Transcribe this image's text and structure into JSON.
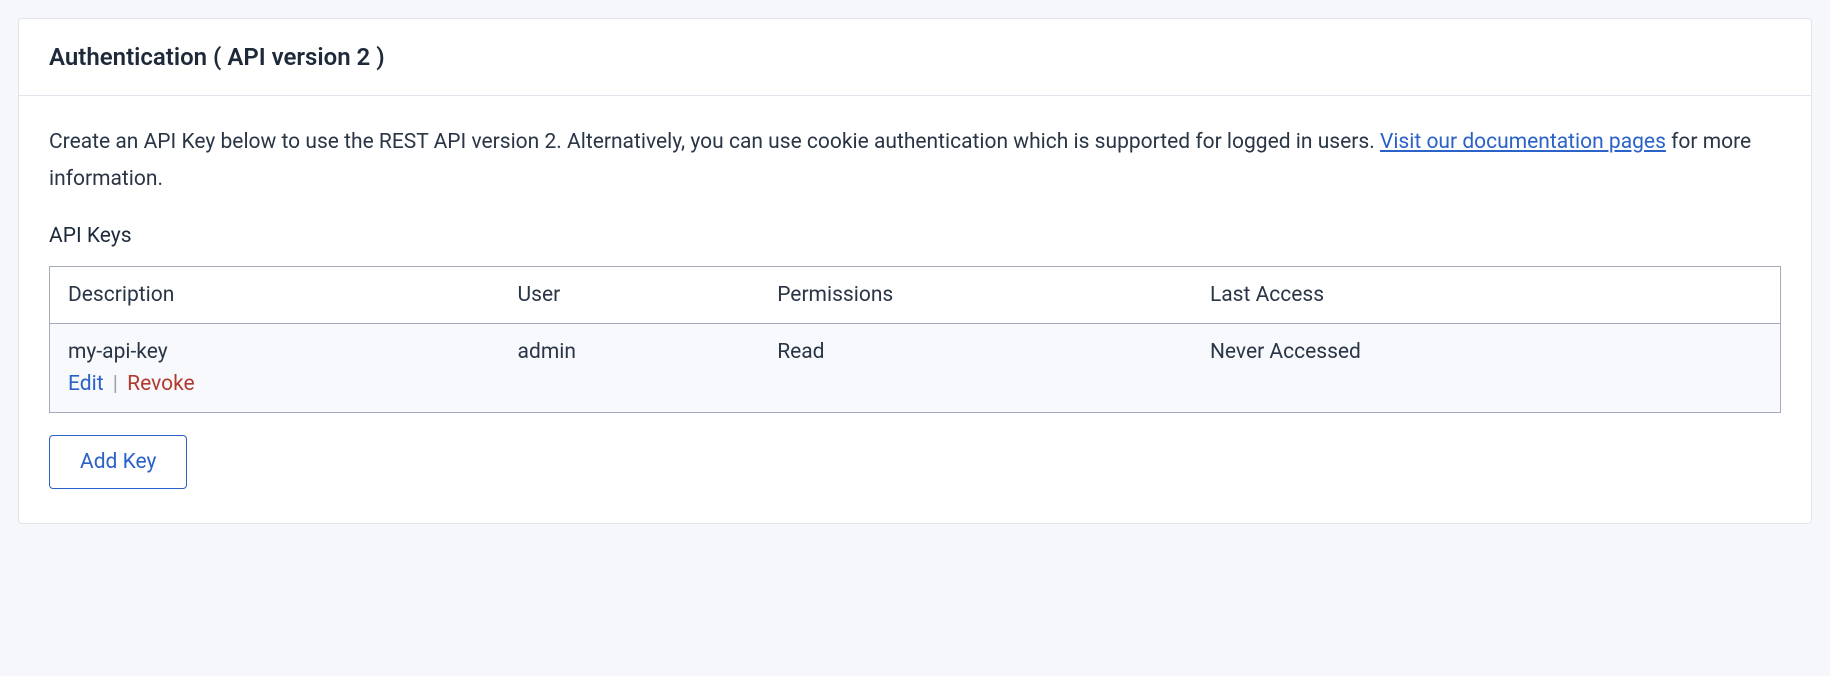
{
  "panel": {
    "title": "Authentication ( API version 2 )",
    "intro_text_before": "Create an API Key below to use the REST API version 2. Alternatively, you can use cookie authentication which is supported for logged in users. ",
    "intro_link": "Visit our documentation pages",
    "intro_text_after": " for more information.",
    "section_heading": "API Keys",
    "table": {
      "headers": {
        "description": "Description",
        "user": "User",
        "permissions": "Permissions",
        "last_access": "Last Access"
      },
      "rows": [
        {
          "description": "my-api-key",
          "user": "admin",
          "permissions": "Read",
          "last_access": "Never Accessed",
          "actions": {
            "edit": "Edit",
            "separator": "|",
            "revoke": "Revoke"
          }
        }
      ]
    },
    "add_key_label": "Add Key"
  }
}
